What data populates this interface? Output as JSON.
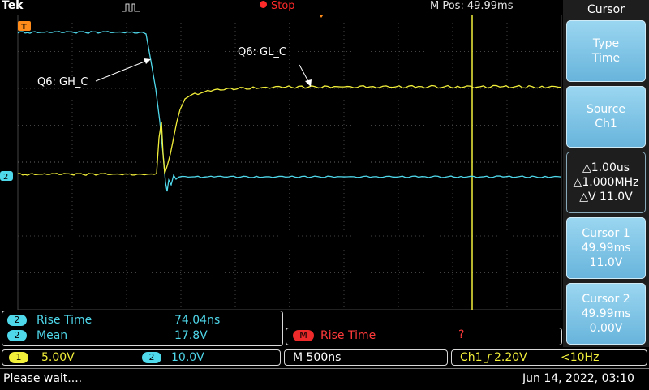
{
  "brand": "Tek",
  "status": {
    "acquisition": "Stop"
  },
  "horizontal_position": {
    "label": "M Pos:",
    "value": "49.99ms"
  },
  "side_menu": {
    "title": "Cursor",
    "buttons": [
      {
        "line1": "Type",
        "line2": "Time",
        "line3": ""
      },
      {
        "line1": "Source",
        "line2": "Ch1",
        "line3": ""
      },
      {
        "line1": "△1.00us",
        "line2": "△1.000MHz",
        "line3": "△V 11.0V"
      },
      {
        "line1": "Cursor 1",
        "line2": "49.99ms",
        "line3": "11.0V"
      },
      {
        "line1": "Cursor 2",
        "line2": "49.99ms",
        "line3": "0.00V"
      }
    ]
  },
  "annotations": {
    "q6_gh": "Q6: GH_C",
    "q6_gl": "Q6: GL_C"
  },
  "markers": {
    "trigger_marker": "T",
    "ch2_ground": "2"
  },
  "measurements": [
    {
      "channel": "2",
      "name": "Rise Time",
      "value": "74.04ns"
    },
    {
      "channel": "2",
      "name": "Mean",
      "value": "17.8V"
    }
  ],
  "math_measurement": {
    "channel": "M",
    "name": "Rise Time",
    "value": "?"
  },
  "channels": [
    {
      "id": "1",
      "scale": "5.00V",
      "color": "#f2ef3a"
    },
    {
      "id": "2",
      "scale": "10.0V",
      "color": "#4fd7ea"
    }
  ],
  "timebase": "M 500ns",
  "trigger": {
    "source": "Ch1",
    "slope_icon": "rising-edge-icon",
    "level": "2.20V",
    "frequency": "<10Hz"
  },
  "status_message": "Please wait....",
  "datetime": "Jun 14, 2022, 03:10",
  "colors": {
    "ch1": "#f2ef3a",
    "ch2": "#4fd7ea",
    "stop": "#ff2a2a",
    "menu": "#7cc4e6"
  }
}
